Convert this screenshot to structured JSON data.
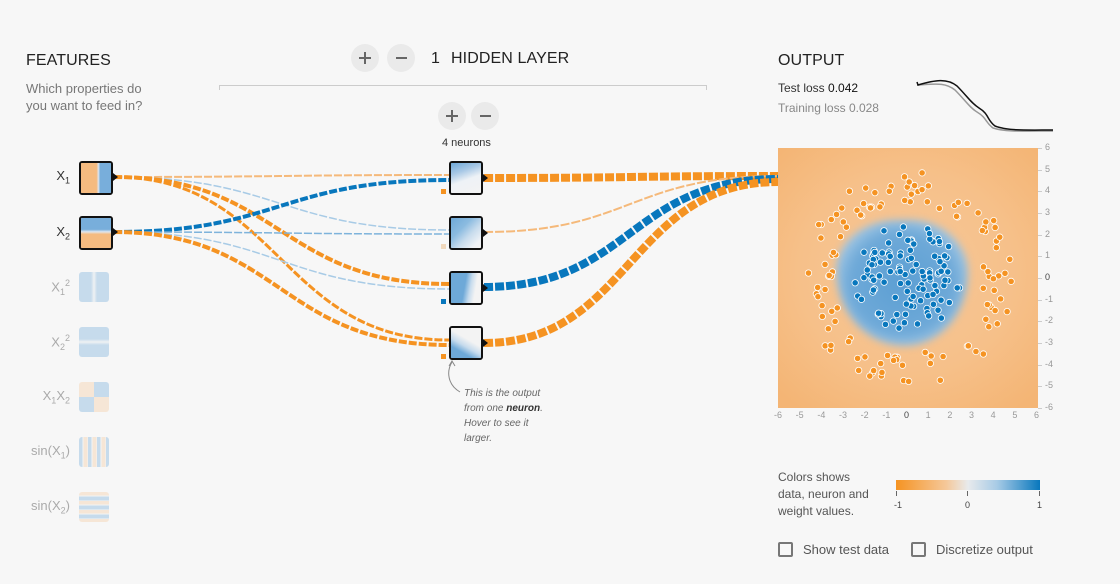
{
  "features": {
    "title": "FEATURES",
    "subtitle_line1": "Which properties do",
    "subtitle_line2": "you want to feed in?",
    "items": [
      {
        "id": "x1",
        "label": "X",
        "sub": "1",
        "sup": "",
        "active": true
      },
      {
        "id": "x2",
        "label": "X",
        "sub": "2",
        "sup": "",
        "active": true
      },
      {
        "id": "x1sq",
        "label": "X",
        "sub": "1",
        "sup": "2",
        "active": false
      },
      {
        "id": "x2sq",
        "label": "X",
        "sub": "2",
        "sup": "2",
        "active": false
      },
      {
        "id": "x1x2",
        "label": "X",
        "sub": "1",
        "label2": "X",
        "sub2": "2",
        "active": false
      },
      {
        "id": "sinx1",
        "label": "sin(X",
        "sub": "1",
        "suffix": ")",
        "active": false
      },
      {
        "id": "sinx2",
        "label": "sin(X",
        "sub": "2",
        "suffix": ")",
        "active": false
      }
    ]
  },
  "hidden": {
    "count": "1",
    "title": "HIDDEN LAYER",
    "neurons_label": "4 neurons",
    "add_layer_icon": "plus-icon",
    "remove_layer_icon": "minus-icon",
    "annotation_line1": "This is the output",
    "annotation_line2_pre": "from one ",
    "annotation_line2_bold": "neuron",
    "annotation_line2_post": ".",
    "annotation_line3": "Hover to see it",
    "annotation_line4": "larger."
  },
  "output": {
    "title": "OUTPUT",
    "test_loss_label": "Test loss",
    "test_loss_value": "0.042",
    "training_loss_label": "Training loss",
    "training_loss_value": "0.028",
    "y_ticks": [
      "6",
      "5",
      "4",
      "3",
      "2",
      "1",
      "0",
      "-1",
      "-2",
      "-3",
      "-4",
      "-5",
      "-6"
    ],
    "x_ticks": [
      "-6",
      "-5",
      "-4",
      "-3",
      "-2",
      "-1",
      "0",
      "1",
      "2",
      "3",
      "4",
      "5",
      "6"
    ],
    "legend_text_line1": "Colors shows",
    "legend_text_line2": "data, neuron and",
    "legend_text_line3": "weight values.",
    "legend_ticks": [
      "-1",
      "0",
      "1"
    ],
    "show_test_data_label": "Show test data",
    "show_test_data_checked": false,
    "discretize_label": "Discretize output",
    "discretize_checked": false
  },
  "colors": {
    "orange": "#f59322",
    "blue": "#0877bd",
    "light_orange": "#f5b97a",
    "light_blue": "#7eb3db"
  }
}
